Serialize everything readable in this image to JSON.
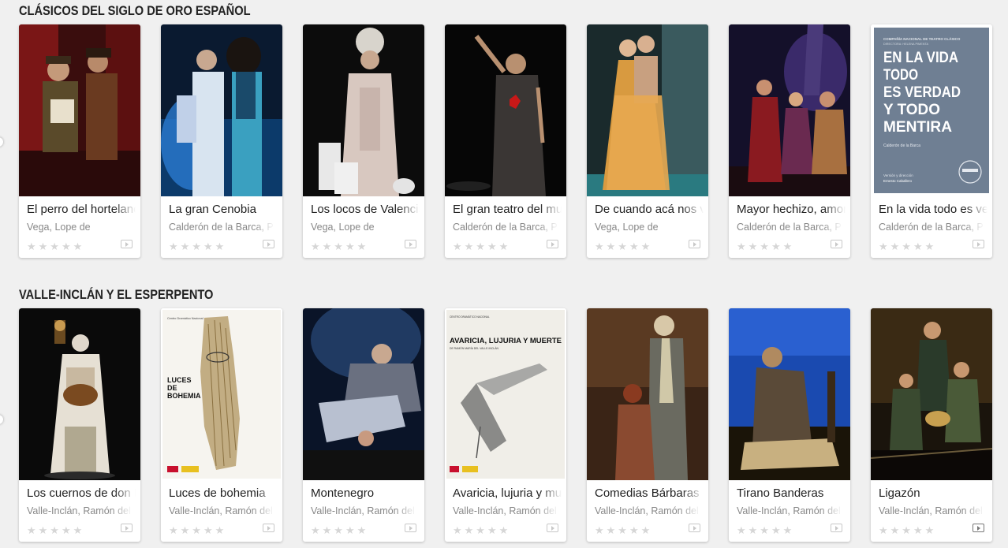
{
  "sections": [
    {
      "title": "CLÁSICOS DEL SIGLO DE ORO ESPAÑOL",
      "items": [
        {
          "title": "El perro del hortelano",
          "author": "Vega, Lope de"
        },
        {
          "title": "La gran Cenobia",
          "author": "Calderón de la Barca, Pedro"
        },
        {
          "title": "Los locos de Valencia",
          "author": "Vega, Lope de"
        },
        {
          "title": "El gran teatro del mundo",
          "author": "Calderón de la Barca, Pedro"
        },
        {
          "title": "De cuando acá nos vino",
          "author": "Vega, Lope de"
        },
        {
          "title": "Mayor hechizo, amor",
          "author": "Calderón de la Barca, Pedro"
        },
        {
          "title": "En la vida todo es verdad y todo mentira",
          "author": "Calderón de la Barca, Pedro"
        }
      ]
    },
    {
      "title": "VALLE-INCLÁN Y EL ESPERPENTO",
      "items": [
        {
          "title": "Los cuernos de don Friolera",
          "author": "Valle-Inclán, Ramón del"
        },
        {
          "title": "Luces de bohemia",
          "author": "Valle-Inclán, Ramón del"
        },
        {
          "title": "Montenegro",
          "author": "Valle-Inclán, Ramón del"
        },
        {
          "title": "Avaricia, lujuria y muerte",
          "author": "Valle-Inclán, Ramón del"
        },
        {
          "title": "Comedias Bárbaras",
          "author": "Valle-Inclán, Ramón del"
        },
        {
          "title": "Tirano Banderas",
          "author": "Valle-Inclán, Ramón del"
        },
        {
          "title": "Ligazón",
          "author": "Valle-Inclán, Ramón del"
        }
      ]
    }
  ],
  "posters": {
    "en_la_vida": {
      "company": "COMPAÑÍA NACIONAL DE TEATRO CLÁSICO",
      "direction": "DIRECTORA: HELENA PIMENTA",
      "title_lines": [
        "EN LA VIDA",
        "TODO",
        "ES VERDAD",
        "Y TODO",
        "MENTIRA"
      ],
      "author": "Calderón de la Barca",
      "credit_label": "Versión y dirección",
      "credit_name": "Ernesto Caballero"
    },
    "luces": {
      "header": "Centro Dramático Nacional",
      "title_lines": [
        "LUCES",
        "DE",
        "BOHEMIA"
      ]
    },
    "avaricia": {
      "header": "CENTRO DRAMÁTICO NACIONAL",
      "title": "AVARICIA, LUJURIA Y MUERTE",
      "subtitle": "DE RAMÓN MARÍA DEL VALLE-INCLÁN"
    }
  },
  "colors": {
    "background": "#f0f0f0",
    "card": "#ffffff",
    "title_text": "#222222",
    "author_text": "#888888",
    "star_empty": "#d6d6d6"
  },
  "icons": {
    "rating": "star-icon",
    "media": "video-play-icon"
  }
}
